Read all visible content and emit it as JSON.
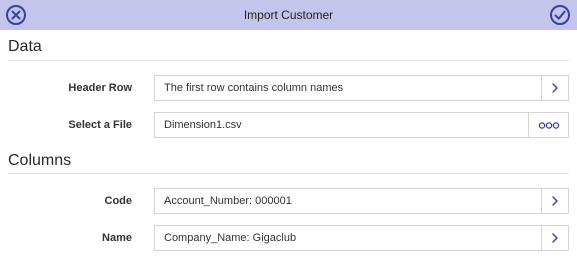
{
  "dialog": {
    "title": "Import Customer",
    "accent_color": "#3a3fa8",
    "titlebar_color": "#c3c5ea"
  },
  "sections": {
    "data": {
      "header": "Data",
      "header_row": {
        "label": "Header Row",
        "value": "The first row contains column names",
        "icon": "chevron-right-icon"
      },
      "select_file": {
        "label": "Select a File",
        "value": "Dimension1.csv",
        "icon": "ellipsis-icon"
      }
    },
    "columns": {
      "header": "Columns",
      "code": {
        "label": "Code",
        "value": "Account_Number: 000001",
        "icon": "chevron-right-icon"
      },
      "name": {
        "label": "Name",
        "value": "Company_Name: Gigaclub",
        "icon": "chevron-right-icon"
      }
    }
  }
}
